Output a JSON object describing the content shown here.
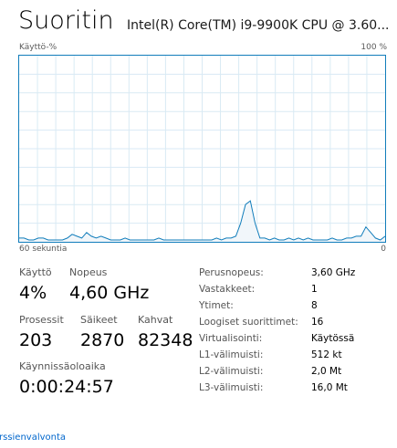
{
  "header": {
    "title": "Suoritin",
    "cpu_name": "Intel(R) Core(TM) i9-9900K CPU @ 3.60..."
  },
  "graph": {
    "label_top_left": "Käyttö-%",
    "label_top_right": "100 %",
    "label_bottom_left": "60 sekuntia",
    "label_bottom_right": "0",
    "line_color": "#117dbb",
    "fill_color": "#f1f6fa",
    "grid_color": "#d9eaf4",
    "usage_percent": [
      2,
      2,
      1,
      1,
      2,
      2,
      1,
      1,
      1,
      1,
      2,
      4,
      3,
      2,
      5,
      3,
      2,
      3,
      2,
      1,
      1,
      1,
      2,
      1,
      1,
      1,
      1,
      1,
      1,
      2,
      1,
      1,
      1,
      1,
      1,
      1,
      1,
      1,
      1,
      1,
      1,
      2,
      1,
      2,
      2,
      3,
      10,
      20,
      22,
      10,
      2,
      2,
      1,
      2,
      1,
      1,
      2,
      1,
      2,
      1,
      2,
      1,
      1,
      1,
      1,
      2,
      1,
      1,
      2,
      2,
      3,
      3,
      8,
      5,
      2,
      1,
      3
    ]
  },
  "stats": {
    "usage_label": "Käyttö",
    "usage_value": "4%",
    "speed_label": "Nopeus",
    "speed_value": "4,60 GHz",
    "processes_label": "Prosessit",
    "processes_value": "203",
    "threads_label": "Säikeet",
    "threads_value": "2870",
    "handles_label": "Kahvat",
    "handles_value": "82348",
    "uptime_label": "Käynnissäoloaika",
    "uptime_value": "0:00:24:57"
  },
  "details": [
    {
      "label": "Perusnopeus:",
      "value": "3,60 GHz"
    },
    {
      "label": "Vastakkeet:",
      "value": "1"
    },
    {
      "label": "Ytimet:",
      "value": "8"
    },
    {
      "label": "Loogiset suorittimet:",
      "value": "16"
    },
    {
      "label": "Virtualisointi:",
      "value": "Käytössä"
    },
    {
      "label": "L1-välimuisti:",
      "value": "512 kt"
    },
    {
      "label": "L2-välimuisti:",
      "value": "2,0 Mt"
    },
    {
      "label": "L3-välimuisti:",
      "value": "16,0 Mt"
    }
  ],
  "footer": {
    "link_text": "rssienvalvonta"
  }
}
